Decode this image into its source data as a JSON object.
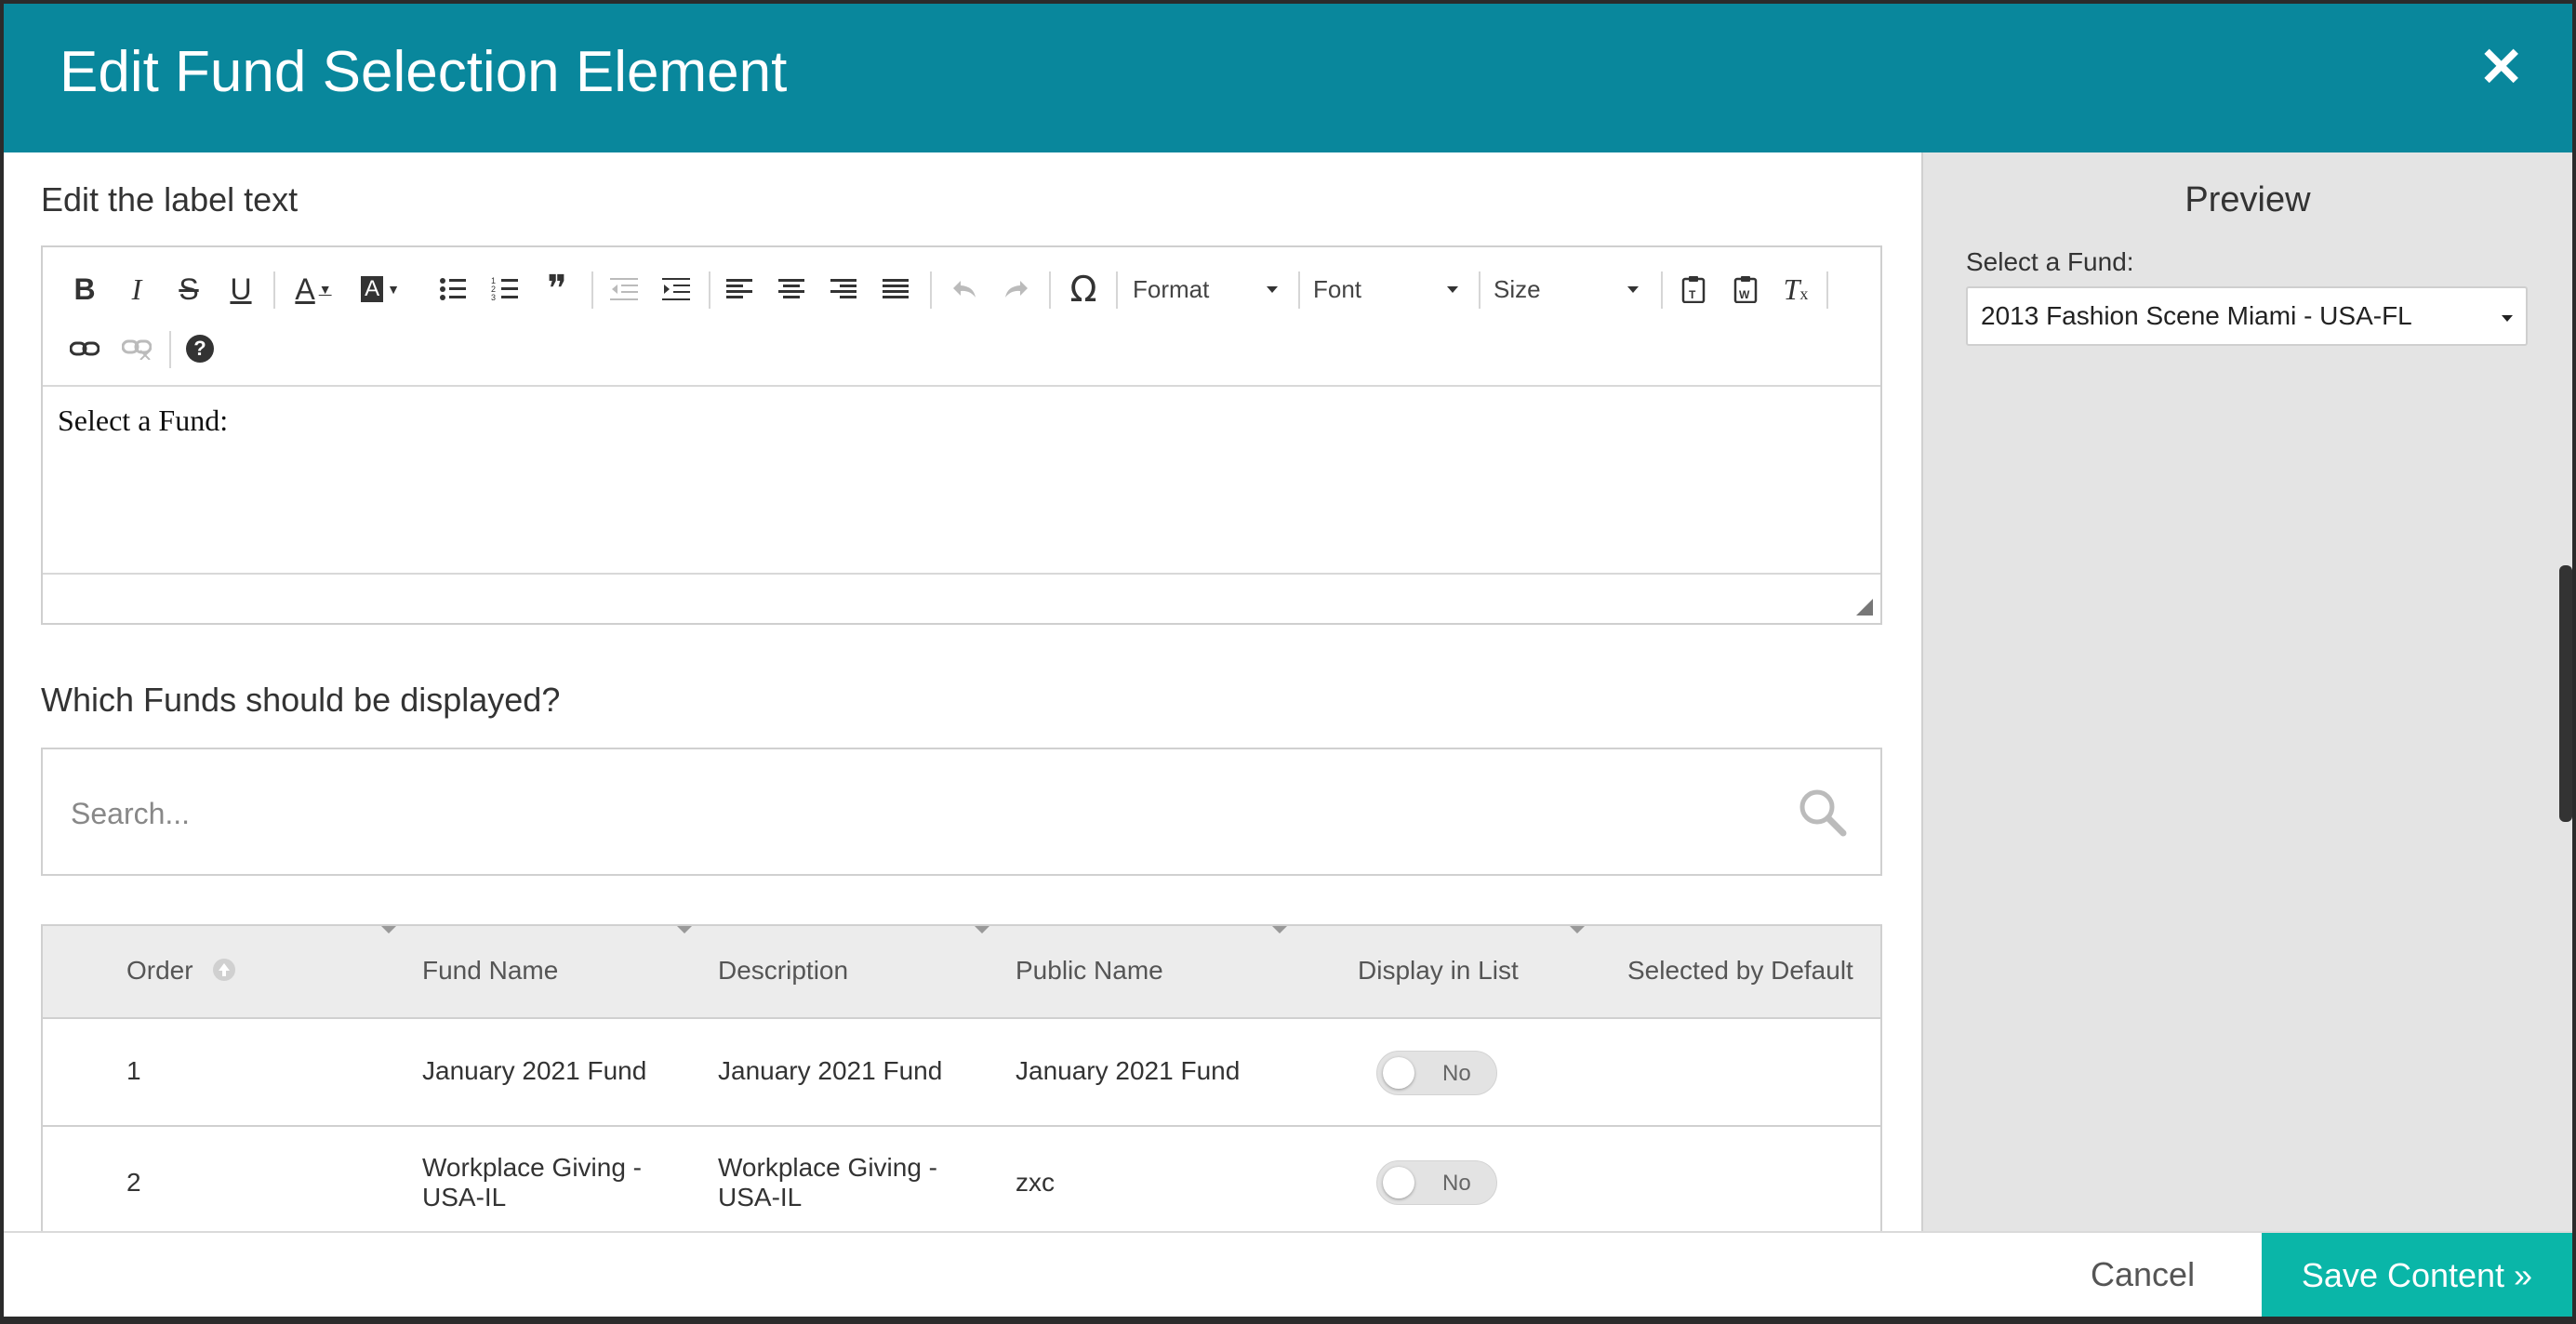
{
  "modal": {
    "title": "Edit Fund Selection Element",
    "close_glyph": "✕"
  },
  "label_section": {
    "heading": "Edit the label text",
    "editor_content": "Select a Fund:"
  },
  "toolbar": {
    "bold": "B",
    "italic": "I",
    "strike": "S",
    "underline": "U",
    "text_color": "A",
    "bg_color": "A",
    "format_label": "Format",
    "font_label": "Font",
    "size_label": "Size",
    "omega": "Ω",
    "quote": "❞",
    "help": "?"
  },
  "funds_section": {
    "heading": "Which Funds should be displayed?",
    "search_placeholder": "Search..."
  },
  "table": {
    "headers": {
      "order": "Order",
      "fund_name": "Fund Name",
      "description": "Description",
      "public_name": "Public Name",
      "display_in_list": "Display in List",
      "selected_by_default": "Selected by Default"
    },
    "rows": [
      {
        "order": "1",
        "fund_name": "January 2021 Fund",
        "description": "January 2021 Fund",
        "public_name": "January 2021 Fund",
        "display_label": "No"
      },
      {
        "order": "2",
        "fund_name_line1": "Workplace Giving -",
        "fund_name_line2": "USA-IL",
        "description_line1": "Workplace Giving -",
        "description_line2": "USA-IL",
        "public_name": "zxc",
        "display_label": "No"
      }
    ]
  },
  "preview": {
    "title": "Preview",
    "label": "Select a Fund:",
    "selected_value": "2013 Fashion Scene Miami - USA-FL"
  },
  "footer": {
    "cancel_label": "Cancel",
    "save_label": "Save Content »"
  },
  "colors": {
    "header": "#09879c",
    "save_button": "#0ab6a8"
  }
}
